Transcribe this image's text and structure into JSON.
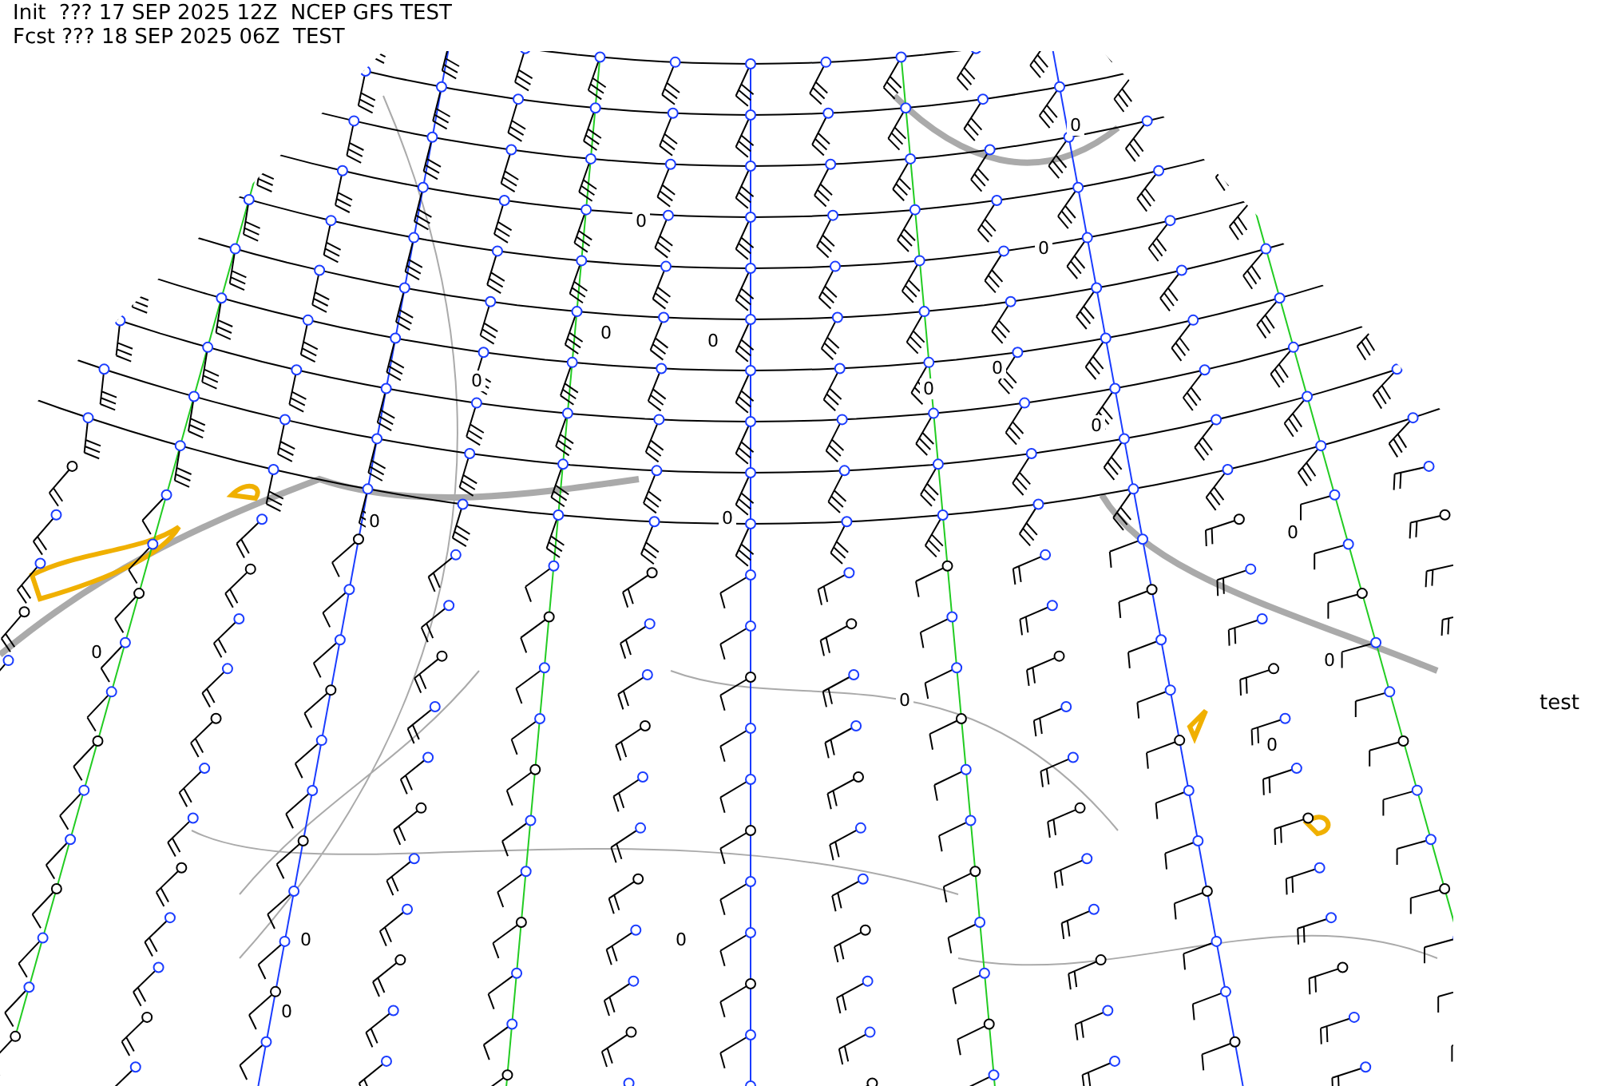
{
  "header": {
    "init_line": "Init  ??? 17 SEP 2025 12Z  NCEP GFS TEST",
    "forecast_line": "Fcst ??? 18 SEP 2025 06Z  TEST"
  },
  "side_label": "test",
  "contour_labels": [
    "0",
    "0",
    "0",
    "0",
    "0",
    "0",
    "0",
    "0",
    "0",
    "0",
    "0",
    "0",
    "0",
    "0",
    "0",
    "0",
    "0",
    "0",
    "0"
  ]
}
